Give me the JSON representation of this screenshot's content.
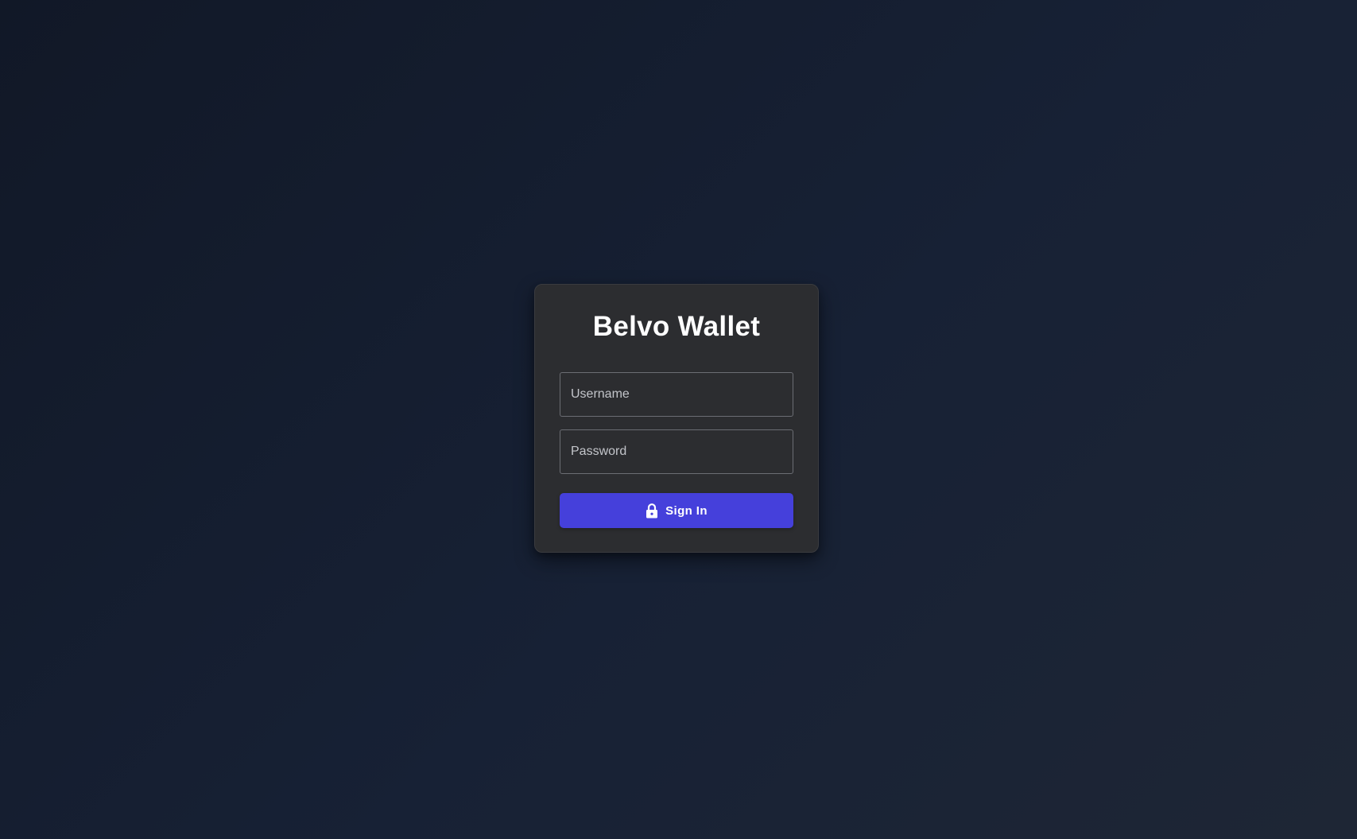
{
  "app": {
    "title": "Belvo Wallet"
  },
  "login_form": {
    "username": {
      "value": "",
      "placeholder": "Username"
    },
    "password": {
      "value": "",
      "placeholder": "Password"
    },
    "submit": {
      "label": "Sign In",
      "icon": "lock-icon"
    }
  },
  "colors": {
    "background": "#141c2b",
    "card": "#2c2d30",
    "input_border": "#6b6d73",
    "accent": "#4540db",
    "text": "#ffffff"
  }
}
